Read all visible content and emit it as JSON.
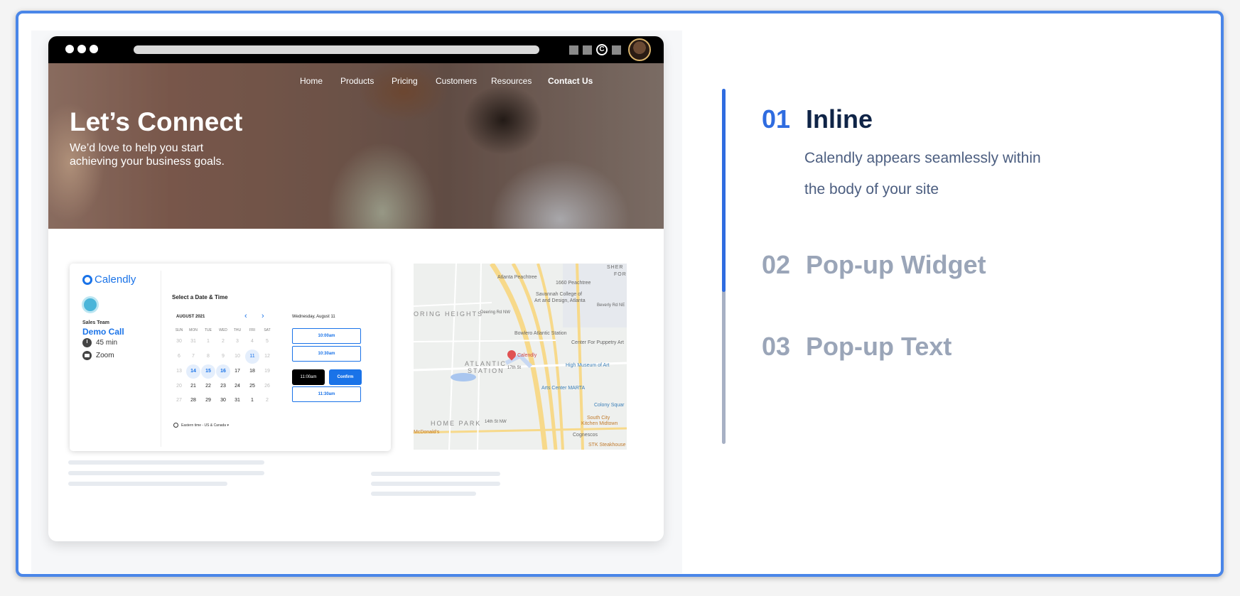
{
  "browser": {
    "nav": [
      "Home",
      "Products",
      "Pricing",
      "Customers",
      "Resources",
      "Contact Us"
    ]
  },
  "hero": {
    "title": "Let’s Connect",
    "subtitle": "We’d love to help you start achieving your business goals."
  },
  "calendly": {
    "brand": "Calendly",
    "team": "Sales Team",
    "event": "Demo Call",
    "duration": "45 min",
    "location": "Zoom",
    "heading": "Select a Date & Time",
    "month": "AUGUST 2021",
    "weekdays": [
      "SUN",
      "MON",
      "TUE",
      "WED",
      "THU",
      "FRI",
      "SAT"
    ],
    "weeks": [
      [
        [
          "30",
          "muted"
        ],
        [
          "31",
          "muted"
        ],
        [
          "1",
          "muted"
        ],
        [
          "2",
          "muted"
        ],
        [
          "3",
          "muted"
        ],
        [
          "4",
          "muted"
        ],
        [
          "5",
          "muted"
        ]
      ],
      [
        [
          "6",
          "muted"
        ],
        [
          "7",
          "muted"
        ],
        [
          "8",
          "muted"
        ],
        [
          "9",
          "muted"
        ],
        [
          "10",
          "muted"
        ],
        [
          "11",
          "today"
        ],
        [
          "12",
          "muted"
        ]
      ],
      [
        [
          "13",
          "muted"
        ],
        [
          "14",
          "avail"
        ],
        [
          "15",
          "avail"
        ],
        [
          "16",
          "avail"
        ],
        [
          "17",
          ""
        ],
        [
          "18",
          ""
        ],
        [
          "19",
          "muted"
        ]
      ],
      [
        [
          "20",
          "muted"
        ],
        [
          "21",
          ""
        ],
        [
          "22",
          ""
        ],
        [
          "23",
          ""
        ],
        [
          "24",
          ""
        ],
        [
          "25",
          ""
        ],
        [
          "26",
          "muted"
        ]
      ],
      [
        [
          "27",
          "muted"
        ],
        [
          "28",
          ""
        ],
        [
          "29",
          ""
        ],
        [
          "30",
          ""
        ],
        [
          "31",
          ""
        ],
        [
          "1",
          ""
        ],
        [
          "2",
          "muted"
        ]
      ]
    ],
    "selected_date": "Wednesday, August 11",
    "slots": [
      "10:00am",
      "10:30am",
      "11:30am"
    ],
    "selected_slot": "11:00am",
    "confirm": "Confirm",
    "timezone": "Eastern time - US & Canada ▾",
    "colors": {
      "primary": "#1a73e8",
      "available_bg": "#e4eefc"
    }
  },
  "map": {
    "labels": {
      "sher": "SHER",
      "for": "FOR",
      "peachtree": "Atlanta Peachtree",
      "p1660": "1660 Peachtree",
      "scad": "Savannah College of",
      "scad2": "Art and Design, Atlanta",
      "beverly": "Beverly Rd NE",
      "oring": "ORING HEIGHTS",
      "deering": "Deering Rd NW",
      "bowlero": "Bowlero Atlantic Station",
      "puppetry": "Center For Puppetry Art",
      "calendly": "Calendly",
      "atlantic": "ATLANTIC",
      "station": "STATION",
      "st17": "17th St",
      "high": "High Museum of Art",
      "arts": "Arts Center MARTA",
      "colony": "Colony Squar",
      "homepark": "HOME PARK",
      "st14": "14th St NW",
      "mcd": "McDonald's",
      "southcity": "South City",
      "kitchen": "Kitchen Midtown",
      "cognescos": "Cognescos",
      "stk": "STK Steakhouse"
    }
  },
  "options": [
    {
      "num": "01",
      "title": "Inline",
      "desc": "Calendly appears seamlessly within the body of your site",
      "active": true
    },
    {
      "num": "02",
      "title": "Pop-up Widget",
      "active": false
    },
    {
      "num": "03",
      "title": "Pop-up Text",
      "active": false
    }
  ],
  "colors": {
    "accent": "#2f6ce0",
    "frame_border": "#4a86e8",
    "active_title": "#0f2447",
    "inactive": "#9aa5b8"
  }
}
